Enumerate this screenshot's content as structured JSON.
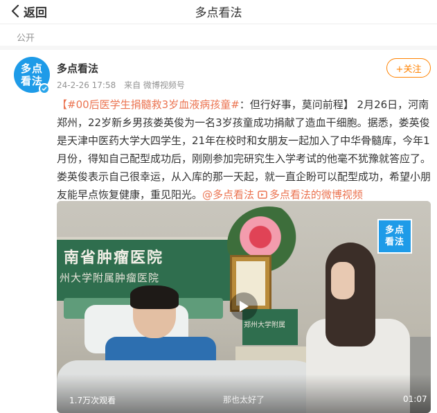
{
  "nav": {
    "back_label": "返回",
    "title": "多点看法"
  },
  "post": {
    "visibility": "公开",
    "author": "多点看法",
    "avatar_text_line1": "多点",
    "avatar_text_line2": "看法",
    "timestamp": "24-2-26 17:58",
    "source": "来自 微博视频号",
    "follow_label": "+关注",
    "content": {
      "hashtag": "【#00后医学生捐髓救3岁血液病孩童#",
      "after_hashtag": "：但行好事，莫问前程】 2月26日，河南郑州，22岁新乡男孩娄英俊为一名3岁孩童成功捐献了造血干细胞。据悉，娄英俊是天津中医药大学大四学生，21年在校时和女朋友一起加入了中华骨髓库，今年1月份，得知自己配型成功后，刚刚参加完研究生入学考试的他毫不犹豫就答应了。娄英俊表示自己很幸运，从入库的那一天起，就一直企盼可以配型成功，希望小朋友能早点恢复健康，重见阳光。",
      "mention": "@多点看法",
      "video_link": "多点看法的微博视频"
    }
  },
  "video": {
    "views": "1.7万次观看",
    "subtitle": "那也太好了",
    "duration": "01:07",
    "logo_line1": "多点",
    "logo_line2": "看法",
    "hospital_sign_line1": "南省肿瘤医院",
    "hospital_sign_line2": "州大学附属肿瘤医院",
    "hospital_sign_small": "郑州大学附属"
  },
  "colors": {
    "accent_orange": "#ff8200",
    "link_color": "#eb7350",
    "brand_blue": "#1e9be8"
  },
  "icons": {
    "back": "chevron-left-icon",
    "verified": "verified-badge-icon",
    "play": "play-icon",
    "video_link": "video-link-icon"
  }
}
